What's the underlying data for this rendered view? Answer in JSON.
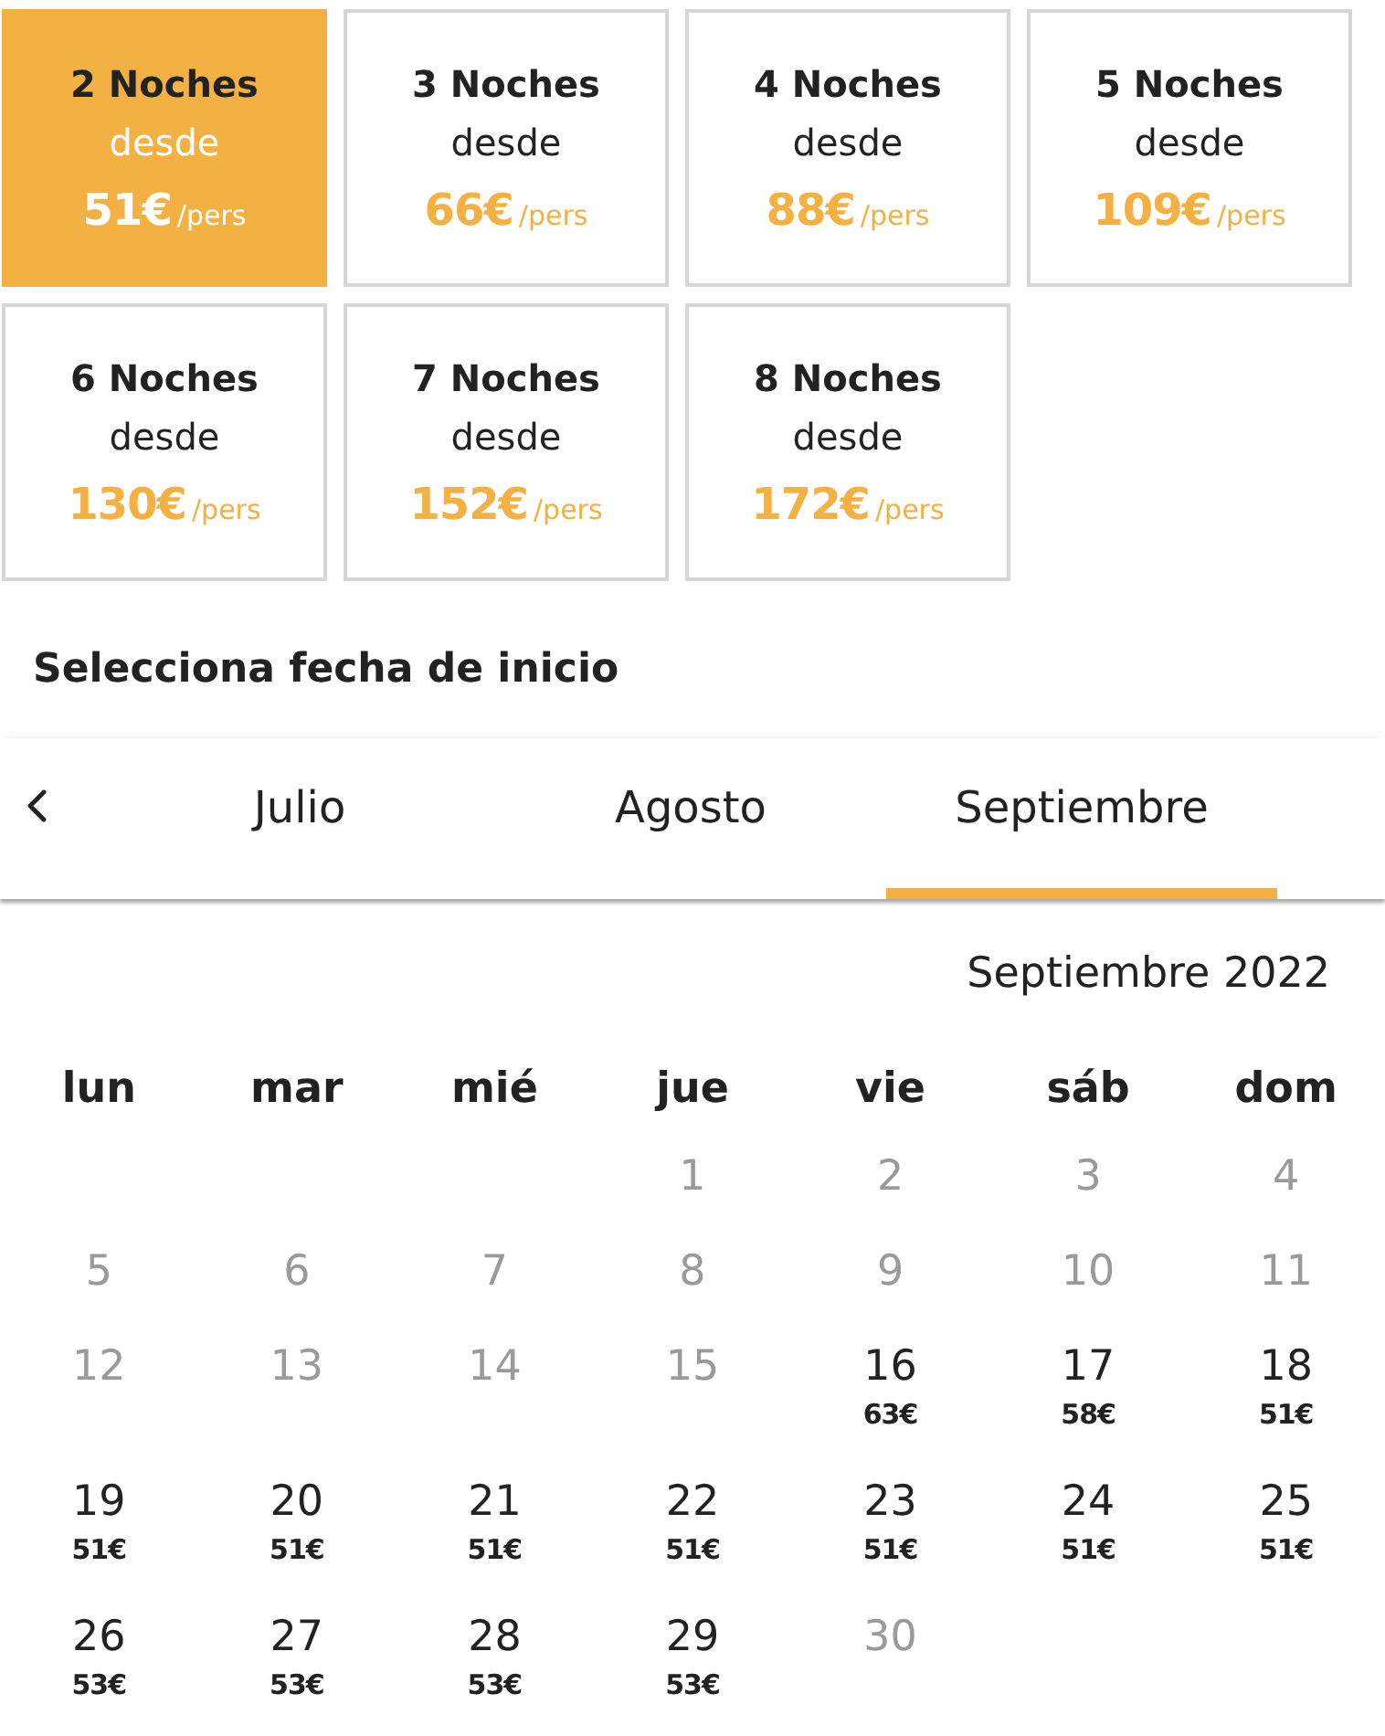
{
  "night_options": [
    {
      "nights": "2 Noches",
      "from": "desde",
      "price": "51€",
      "unit": "/pers",
      "selected": true
    },
    {
      "nights": "3 Noches",
      "from": "desde",
      "price": "66€",
      "unit": "/pers",
      "selected": false
    },
    {
      "nights": "4 Noches",
      "from": "desde",
      "price": "88€",
      "unit": "/pers",
      "selected": false
    },
    {
      "nights": "5 Noches",
      "from": "desde",
      "price": "109€",
      "unit": "/pers",
      "selected": false
    },
    {
      "nights": "6 Noches",
      "from": "desde",
      "price": "130€",
      "unit": "/pers",
      "selected": false
    },
    {
      "nights": "7 Noches",
      "from": "desde",
      "price": "152€",
      "unit": "/pers",
      "selected": false
    },
    {
      "nights": "8 Noches",
      "from": "desde",
      "price": "172€",
      "unit": "/pers",
      "selected": false
    }
  ],
  "heading": "Selecciona fecha de inicio",
  "month_tabs": [
    {
      "label": "Julio",
      "selected": false
    },
    {
      "label": "Agosto",
      "selected": false
    },
    {
      "label": "Septiembre",
      "selected": true
    }
  ],
  "calendar": {
    "title": "Septiembre 2022",
    "weekdays": [
      "lun",
      "mar",
      "mié",
      "jue",
      "vie",
      "sáb",
      "dom"
    ],
    "weeks": [
      {
        "days": [
          {
            "kind": "blank"
          },
          {
            "kind": "blank"
          },
          {
            "kind": "blank"
          },
          {
            "kind": "day",
            "day": "1",
            "disabled": true
          },
          {
            "kind": "day",
            "day": "2",
            "disabled": true
          },
          {
            "kind": "day",
            "day": "3",
            "disabled": true
          },
          {
            "kind": "day",
            "day": "4",
            "disabled": true
          }
        ]
      },
      {
        "days": [
          {
            "kind": "day",
            "day": "5",
            "disabled": true
          },
          {
            "kind": "day",
            "day": "6",
            "disabled": true
          },
          {
            "kind": "day",
            "day": "7",
            "disabled": true
          },
          {
            "kind": "day",
            "day": "8",
            "disabled": true
          },
          {
            "kind": "day",
            "day": "9",
            "disabled": true
          },
          {
            "kind": "day",
            "day": "10",
            "disabled": true
          },
          {
            "kind": "day",
            "day": "11",
            "disabled": true
          }
        ]
      },
      {
        "days": [
          {
            "kind": "day",
            "day": "12",
            "disabled": true
          },
          {
            "kind": "day",
            "day": "13",
            "disabled": true
          },
          {
            "kind": "day",
            "day": "14",
            "disabled": true
          },
          {
            "kind": "day",
            "day": "15",
            "disabled": true
          },
          {
            "kind": "day",
            "day": "16",
            "price": "63€",
            "disabled": false
          },
          {
            "kind": "day",
            "day": "17",
            "price": "58€",
            "disabled": false
          },
          {
            "kind": "day",
            "day": "18",
            "price": "51€",
            "disabled": false
          }
        ]
      },
      {
        "days": [
          {
            "kind": "day",
            "day": "19",
            "price": "51€",
            "disabled": false
          },
          {
            "kind": "day",
            "day": "20",
            "price": "51€",
            "disabled": false
          },
          {
            "kind": "day",
            "day": "21",
            "price": "51€",
            "disabled": false
          },
          {
            "kind": "day",
            "day": "22",
            "price": "51€",
            "disabled": false
          },
          {
            "kind": "day",
            "day": "23",
            "price": "51€",
            "disabled": false
          },
          {
            "kind": "day",
            "day": "24",
            "price": "51€",
            "disabled": false
          },
          {
            "kind": "day",
            "day": "25",
            "price": "51€",
            "disabled": false
          }
        ]
      },
      {
        "days": [
          {
            "kind": "day",
            "day": "26",
            "price": "53€",
            "disabled": false
          },
          {
            "kind": "day",
            "day": "27",
            "price": "53€",
            "disabled": false
          },
          {
            "kind": "day",
            "day": "28",
            "price": "53€",
            "disabled": false
          },
          {
            "kind": "day",
            "day": "29",
            "price": "53€",
            "disabled": false
          },
          {
            "kind": "day",
            "day": "30",
            "disabled": true
          },
          {
            "kind": "blank"
          },
          {
            "kind": "blank"
          }
        ]
      }
    ]
  }
}
